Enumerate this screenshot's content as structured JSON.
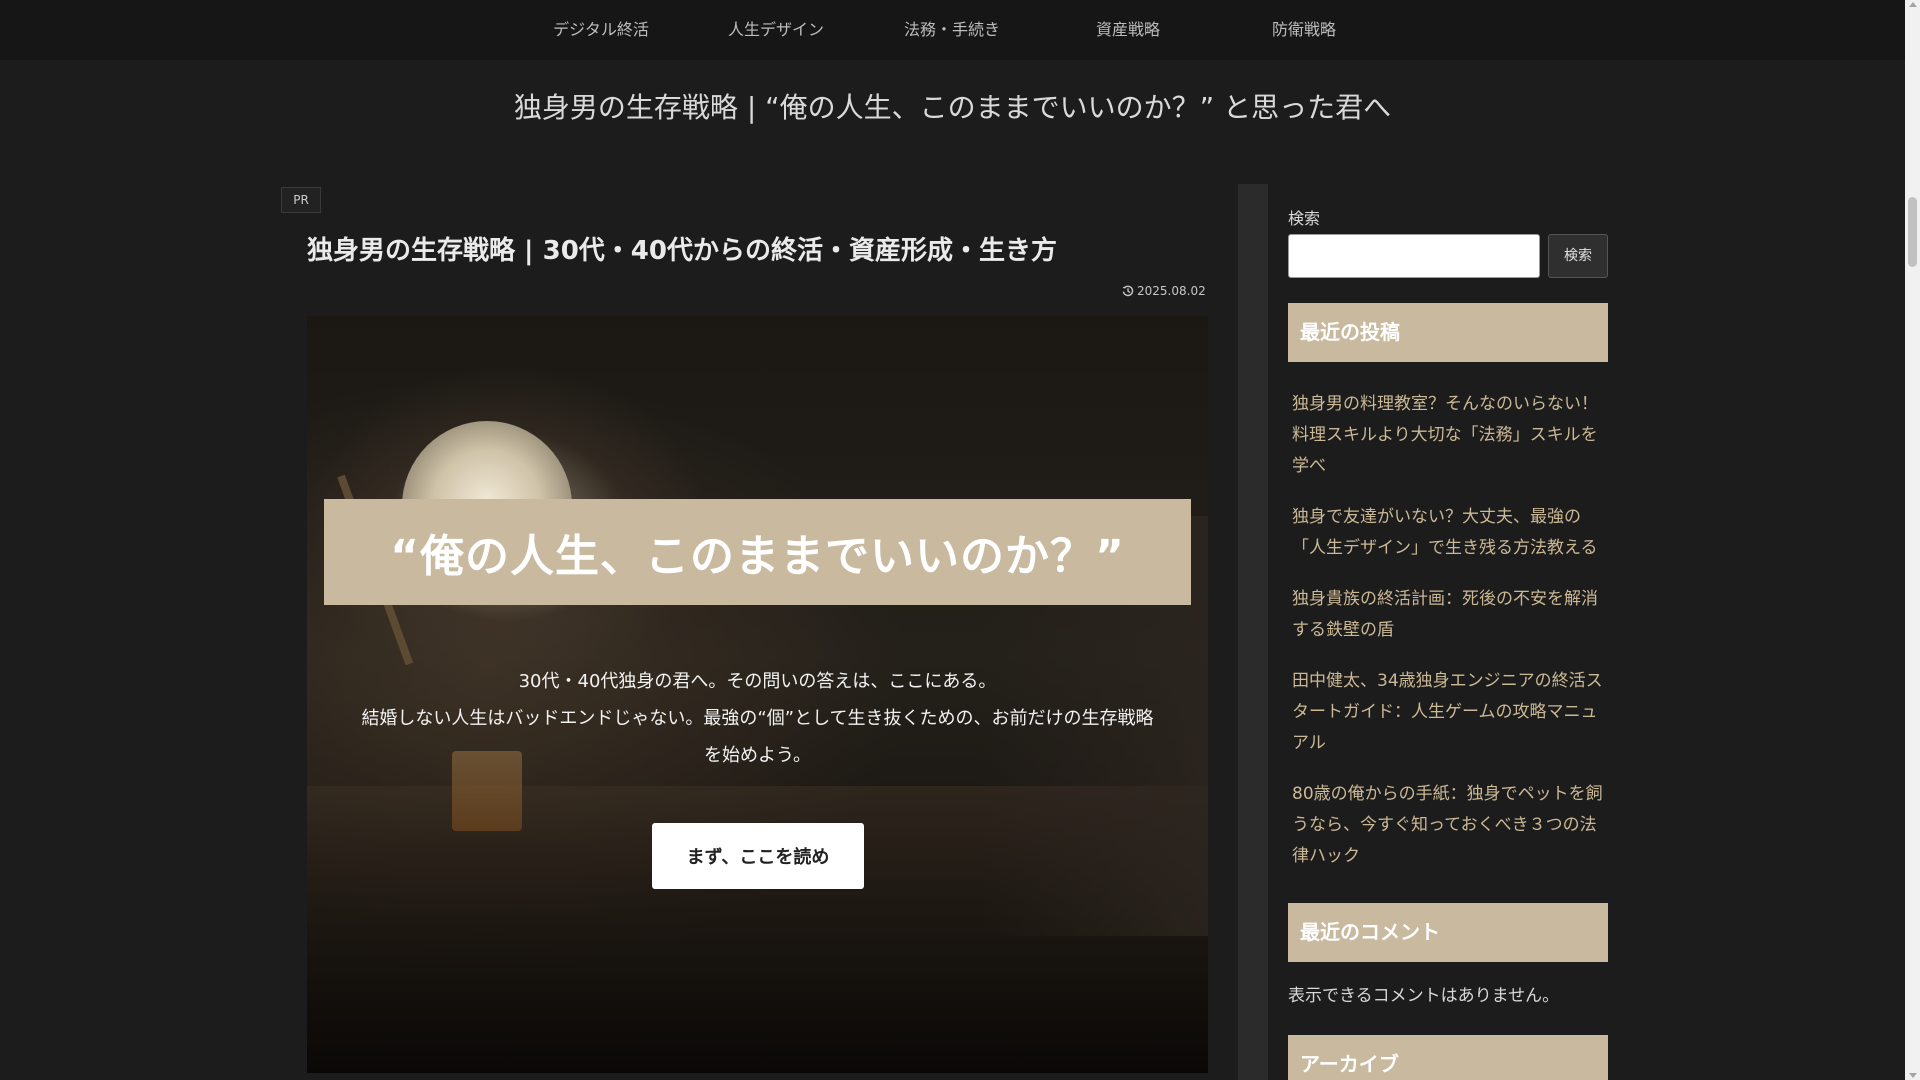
{
  "nav": {
    "items": [
      "デジタル終活",
      "人生デザイン",
      "法務・手続き",
      "資産戦略",
      "防衛戦略"
    ]
  },
  "site": {
    "title": "独身男の生存戦略 | “俺の人生、このままでいいのか？” と思った君へ"
  },
  "post": {
    "badge": "PR",
    "title": "独身男の生存戦略 | 30代・40代からの終活・資産形成・生き方",
    "date": "2025.08.02",
    "date_icon": "history-icon"
  },
  "hero": {
    "headline": "“俺の人生、このままでいいのか？”",
    "lines": [
      "30代・40代独身の君へ。その問いの答えは、ここにある。",
      "結婚しない人生はバッドエンドじゃない。最強の“個”として生き抜くための、お前だけの生存戦略",
      "を始めよう。"
    ],
    "cta": "まず、ここを読め"
  },
  "sidebar": {
    "search_label": "検索",
    "search_button": "検索",
    "search_value": "",
    "recent_posts_heading": "最近の投稿",
    "recent_posts": [
      [
        "独身男の料理教室？そんなのいらない！",
        "料理スキルより大切な「法務」スキルを",
        "学べ"
      ],
      [
        "独身で友達がいない？大丈夫、最強の",
        "「人生デザイン」で生き残る方法教える"
      ],
      [
        "独身貴族の終活計画：死後の不安を解消",
        "する鉄壁の盾"
      ],
      [
        "田中健太、34歳独身エンジニアの終活ス",
        "タートガイド：人生ゲームの攻略マニュ",
        "アル"
      ],
      [
        "80歳の俺からの手紙：独身でペットを飼",
        "うなら、今すぐ知っておくべき３つの法",
        "律ハック"
      ]
    ],
    "recent_comments_heading": "最近のコメント",
    "no_comments": "表示できるコメントはありません。",
    "archive_heading": "アーカイブ"
  },
  "colors": {
    "accent": "#c8b99f",
    "link": "#cbb895",
    "background": "#1c1c1c"
  }
}
